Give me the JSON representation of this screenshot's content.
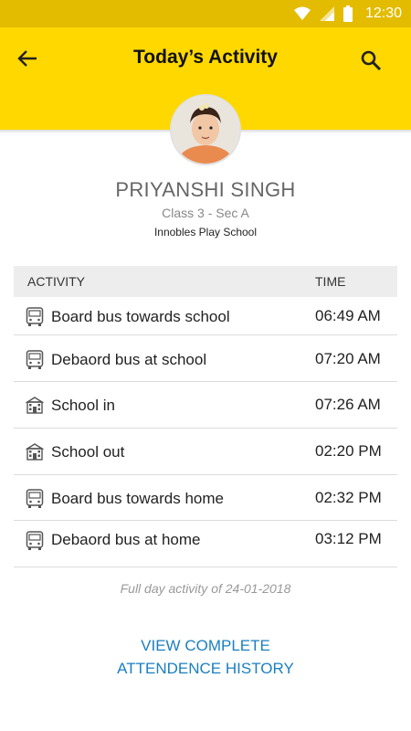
{
  "status_bar": {
    "time": "12:30"
  },
  "app_bar": {
    "title": "Today’s Activity"
  },
  "profile": {
    "name": "PRIYANSHI SINGH",
    "class": "Class 3 - Sec A",
    "school": "Innobles Play School"
  },
  "table": {
    "headers": {
      "activity": "ACTIVITY",
      "time": "TIME"
    },
    "rows": [
      {
        "icon": "bus-icon",
        "label": "Board bus towards school",
        "time": "06:49 AM"
      },
      {
        "icon": "bus-icon",
        "label": "Debaord bus at school",
        "time": "07:20 AM"
      },
      {
        "icon": "school-icon",
        "label": "School in",
        "time": "07:26 AM"
      },
      {
        "icon": "school-icon",
        "label": "School out",
        "time": "02:20 PM"
      },
      {
        "icon": "bus-icon",
        "label": "Board bus towards home",
        "time": "02:32 PM"
      },
      {
        "icon": "bus-icon",
        "label": "Debaord bus at home",
        "time": "03:12 PM"
      }
    ]
  },
  "footer": {
    "note": "Full day activity of 24-01-2018",
    "link_line1": "VIEW COMPLETE",
    "link_line2": "ATTENDENCE HISTORY"
  },
  "colors": {
    "app_bar": "#FFD800",
    "status_bar": "#E3BC00",
    "link": "#1A7FC1"
  }
}
